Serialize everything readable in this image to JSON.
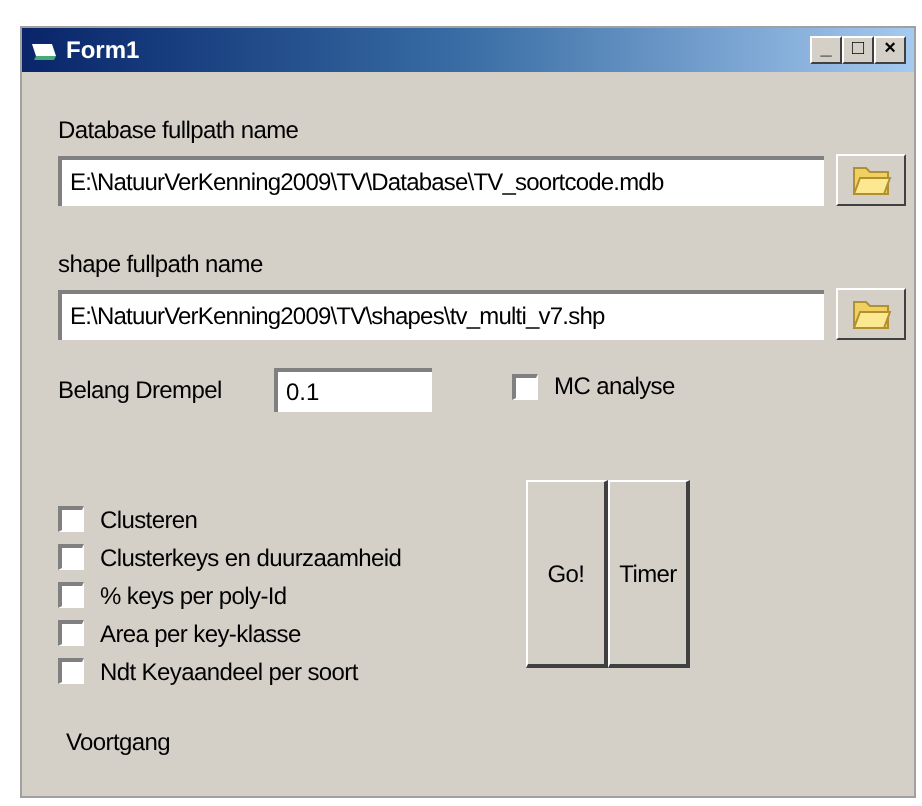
{
  "window": {
    "title": "Form1",
    "controls": [
      "_",
      "□",
      "×"
    ]
  },
  "database": {
    "label": "Database fullpath name",
    "value": "E:\\NatuurVerKenning2009\\TV\\Database\\TV_soortcode.mdb"
  },
  "shape": {
    "label": "shape fullpath name",
    "value": "E:\\NatuurVerKenning2009\\TV\\shapes\\tv_multi_v7.shp"
  },
  "threshold": {
    "label": "Belang Drempel",
    "value": "0.1"
  },
  "mc_analysis": {
    "label": "MC analyse",
    "checked": false
  },
  "options": [
    {
      "label": "Clusteren",
      "checked": false
    },
    {
      "label": "Clusterkeys en duurzaamheid",
      "checked": false
    },
    {
      "label": "% keys per poly-Id",
      "checked": false
    },
    {
      "label": "Area per key-klasse",
      "checked": false
    },
    {
      "label": "Ndt Keyaandeel per soort",
      "checked": false
    }
  ],
  "buttons": [
    "Go!",
    "Timer"
  ],
  "progress_label": "Voortgang"
}
